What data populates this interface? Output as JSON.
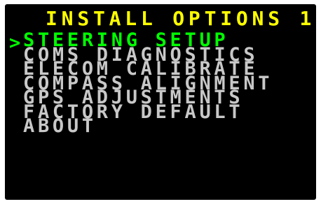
{
  "colors": {
    "background": "#000000",
    "title": "#ffff00",
    "selected": "#00ff00",
    "item": "#c8c8c8"
  },
  "title": "INSTALL OPTIONS 1",
  "cursor": ">",
  "selected_index": 0,
  "menu": {
    "items": [
      {
        "label": "STEERING SETUP"
      },
      {
        "label": "COMS DIAGNOSTICS"
      },
      {
        "label": "ELECOM CALIBRATE"
      },
      {
        "label": "COMPASS ALIGNMENT"
      },
      {
        "label": "GPS ADJUSTMENTS"
      },
      {
        "label": "FACTORY DEFAULT"
      },
      {
        "label": "ABOUT"
      }
    ]
  }
}
